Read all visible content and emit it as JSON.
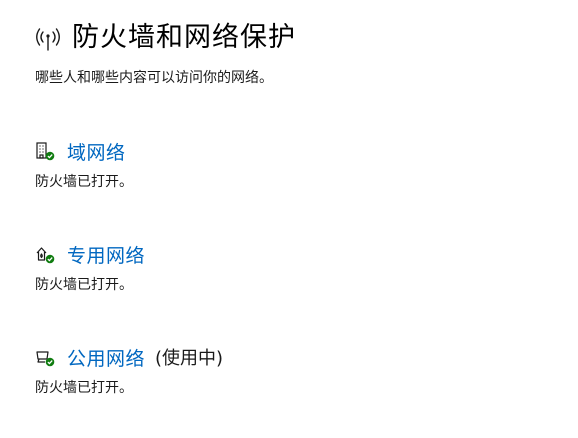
{
  "header": {
    "icon": "wireless-antenna-icon",
    "title": "防火墙和网络保护"
  },
  "subtitle": "哪些人和哪些内容可以访问你的网络。",
  "colors": {
    "link": "#0067c0",
    "status_ok": "#107c10",
    "text": "#1a1a1a"
  },
  "networks": [
    {
      "icon": "domain-network-icon",
      "label": "域网络",
      "in_use": "",
      "status": "防火墙已打开。"
    },
    {
      "icon": "private-network-icon",
      "label": "专用网络",
      "in_use": "",
      "status": "防火墙已打开。"
    },
    {
      "icon": "public-network-icon",
      "label": "公用网络",
      "in_use": "(使用中)",
      "status": "防火墙已打开。"
    }
  ]
}
